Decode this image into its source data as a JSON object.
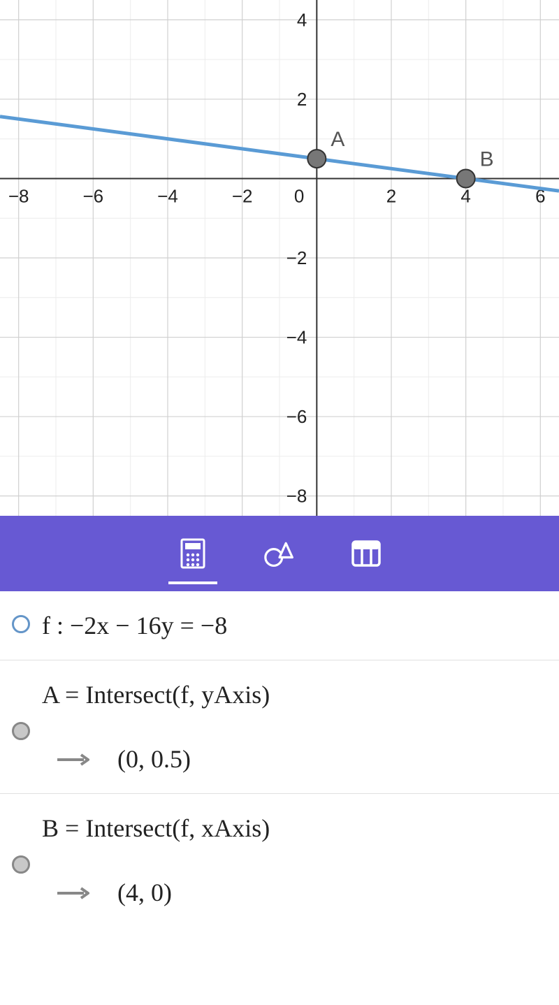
{
  "chart_data": {
    "type": "line",
    "equation": "-2x - 16y = -8",
    "line": {
      "slope": -0.125,
      "intercept": 0.5
    },
    "xlim": [
      -8.5,
      6.5
    ],
    "ylim": [
      -8.5,
      4.5
    ],
    "x_ticks": [
      -8,
      -6,
      -4,
      -2,
      0,
      2,
      4,
      6
    ],
    "y_ticks": [
      -8,
      -6,
      -4,
      -2,
      2,
      4
    ],
    "points": [
      {
        "name": "A",
        "x": 0,
        "y": 0.5
      },
      {
        "name": "B",
        "x": 4,
        "y": 0
      }
    ],
    "grid": true
  },
  "algebra": {
    "f_label": "f : −2x − 16y  =  −8",
    "A_def": "A  =  Intersect(f, yAxis)",
    "A_val": "(0, 0.5)",
    "B_def": "B  =  Intersect(f, xAxis)",
    "B_val": "(4, 0)"
  },
  "toolbar": {
    "algebra_icon": "algebra",
    "tools_icon": "tools",
    "table_icon": "table"
  }
}
